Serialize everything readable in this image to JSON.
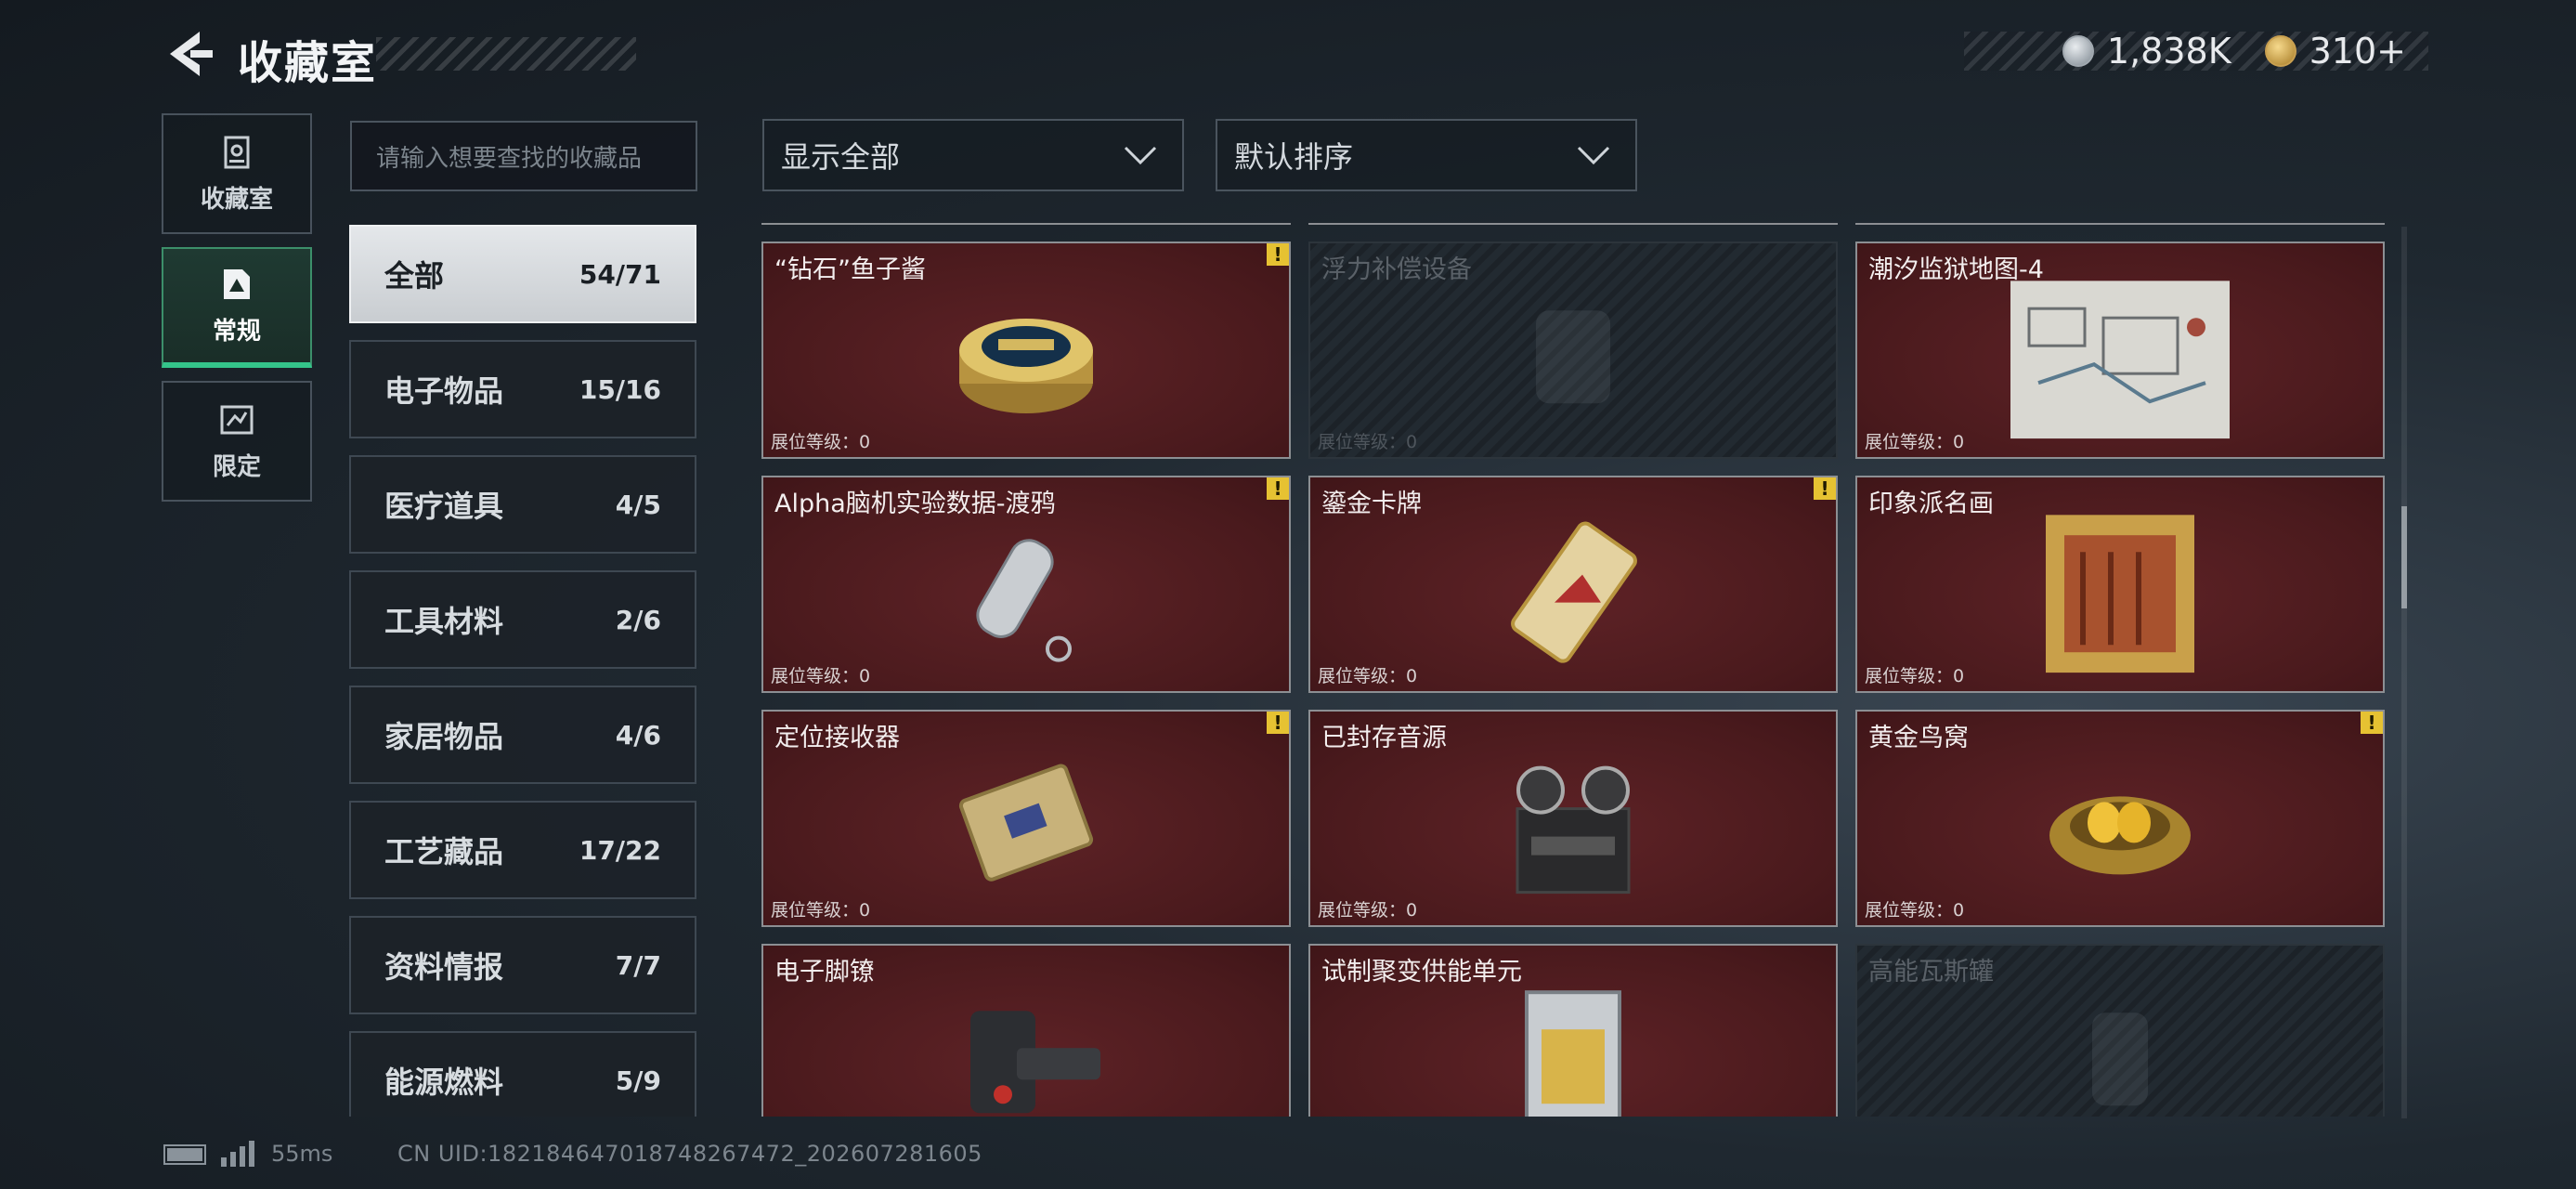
{
  "header": {
    "title": "收藏室"
  },
  "currency": {
    "silver": "1,838K",
    "gold": "310+"
  },
  "nav_tabs": [
    {
      "label": "收藏室",
      "icon": "trophy-case-icon",
      "active": false
    },
    {
      "label": "常规",
      "icon": "document-icon",
      "active": true
    },
    {
      "label": "限定",
      "icon": "limited-icon",
      "active": false
    }
  ],
  "search": {
    "placeholder": "请输入想要查找的收藏品"
  },
  "categories": [
    {
      "name": "全部",
      "count": "54/71",
      "active": true
    },
    {
      "name": "电子物品",
      "count": "15/16"
    },
    {
      "name": "医疗道具",
      "count": "4/5"
    },
    {
      "name": "工具材料",
      "count": "2/6"
    },
    {
      "name": "家居物品",
      "count": "4/6"
    },
    {
      "name": "工艺藏品",
      "count": "17/22"
    },
    {
      "name": "资料情报",
      "count": "7/7"
    },
    {
      "name": "能源燃料",
      "count": "5/9"
    }
  ],
  "filters": {
    "display": "显示全部",
    "sort": "默认排序"
  },
  "level_label": "展位等级：0",
  "items": [
    {
      "name": "“钻石”鱼子酱",
      "owned": true,
      "new": true,
      "icon": "caviar-tin-icon"
    },
    {
      "name": "浮力补偿设备",
      "owned": false,
      "new": false,
      "icon": "bcd-vest-icon"
    },
    {
      "name": "潮汐监狱地图-4",
      "owned": true,
      "new": false,
      "icon": "prison-map-icon"
    },
    {
      "name": "Alpha脑机实验数据-渡鸦",
      "owned": true,
      "new": true,
      "icon": "data-capsule-icon"
    },
    {
      "name": "鎏金卡牌",
      "owned": true,
      "new": true,
      "icon": "gilded-card-icon"
    },
    {
      "name": "印象派名画",
      "owned": true,
      "new": false,
      "icon": "framed-painting-icon"
    },
    {
      "name": "定位接收器",
      "owned": true,
      "new": true,
      "icon": "locator-receiver-icon"
    },
    {
      "name": "已封存音源",
      "owned": true,
      "new": false,
      "icon": "reel-recorder-icon"
    },
    {
      "name": "黄金鸟窝",
      "owned": true,
      "new": true,
      "icon": "golden-nest-icon"
    },
    {
      "name": "电子脚镣",
      "owned": true,
      "new": false,
      "icon": "ankle-monitor-icon"
    },
    {
      "name": "试制聚变供能单元",
      "owned": true,
      "new": false,
      "icon": "fusion-cell-icon"
    },
    {
      "name": "高能瓦斯罐",
      "owned": false,
      "new": false,
      "icon": "gas-canister-icon"
    }
  ],
  "footer": {
    "ping": "55ms",
    "uid": "CN UID:18218464701874826​7472_202607281605"
  },
  "colors": {
    "accent_green": "#34c48a",
    "card_red": "#4a1a1d",
    "warning_yellow": "#e6c232"
  }
}
